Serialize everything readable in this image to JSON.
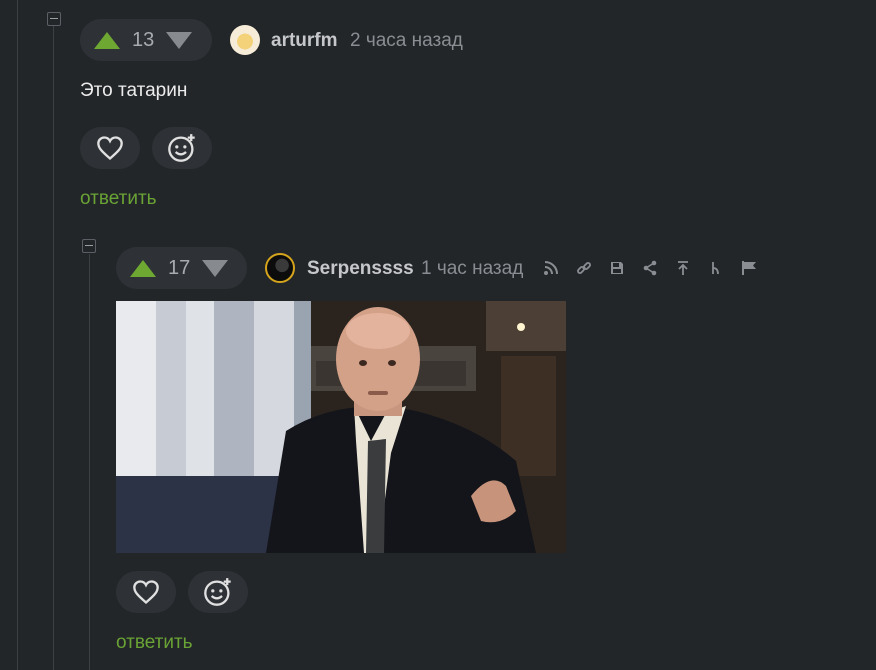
{
  "comments": [
    {
      "rating": "13",
      "username": "arturfm",
      "time": "2 часа назад",
      "text": "Это татарин",
      "reply_label": "ответить"
    },
    {
      "rating": "17",
      "username": "Serpenssss",
      "time": "1 час назад",
      "reply_label": "ответить",
      "toolbar_icons": [
        "subscribe-icon",
        "link-icon",
        "save-icon",
        "share-icon",
        "scroll-top-icon",
        "branch-icon",
        "flag-icon"
      ]
    }
  ],
  "colors": {
    "background": "#232629",
    "upvote": "#6ea832",
    "reply": "#6aa335",
    "pill": "#2e3236"
  }
}
